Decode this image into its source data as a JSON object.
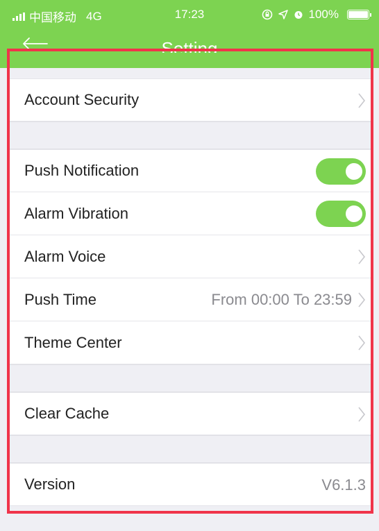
{
  "status_bar": {
    "carrier": "中国移动",
    "network": "4G",
    "time": "17:23",
    "battery": "100%",
    "battery_level": 1.0
  },
  "nav": {
    "title": "Setting",
    "back_icon": "arrow-left-icon"
  },
  "rows": {
    "account_security": {
      "label": "Account Security"
    },
    "push_notification": {
      "label": "Push Notification",
      "enabled": true
    },
    "alarm_vibration": {
      "label": "Alarm Vibration",
      "enabled": true
    },
    "alarm_voice": {
      "label": "Alarm Voice"
    },
    "push_time": {
      "label": "Push Time",
      "value": "From 00:00 To 23:59"
    },
    "theme_center": {
      "label": "Theme Center"
    },
    "clear_cache": {
      "label": "Clear Cache"
    },
    "version": {
      "label": "Version",
      "value": "V6.1.3"
    }
  },
  "colors": {
    "accent": "#7dd351",
    "background": "#efeff4",
    "highlight_frame": "#f0344a"
  }
}
